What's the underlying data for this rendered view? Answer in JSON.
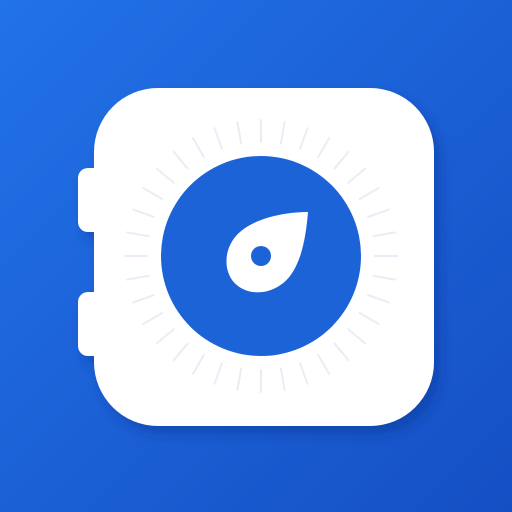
{
  "icon": {
    "name": "safe-vault-app-icon",
    "colors": {
      "background_top": "#2272e8",
      "background_bottom": "#154fc4",
      "body": "#ffffff",
      "dial": "#1d63d8",
      "ticks": "#e9eef6",
      "knob": "#ffffff"
    }
  }
}
